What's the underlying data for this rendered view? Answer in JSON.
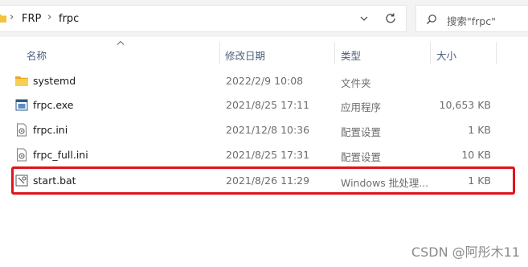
{
  "address_bar": {
    "breadcrumbs": [
      "FRP",
      "frpc"
    ],
    "search_placeholder": "搜索\"frpc\""
  },
  "columns": {
    "name": "名称",
    "date": "修改日期",
    "type": "类型",
    "size": "大小"
  },
  "files": [
    {
      "name": "systemd",
      "date": "2022/2/9 10:08",
      "type": "文件夹",
      "size": "",
      "icon": "folder-icon"
    },
    {
      "name": "frpc.exe",
      "date": "2021/8/25 17:11",
      "type": "应用程序",
      "size": "10,653 KB",
      "icon": "exe-icon"
    },
    {
      "name": "frpc.ini",
      "date": "2021/12/8 10:36",
      "type": "配置设置",
      "size": "1 KB",
      "icon": "ini-icon"
    },
    {
      "name": "frpc_full.ini",
      "date": "2021/8/25 17:31",
      "type": "配置设置",
      "size": "10 KB",
      "icon": "ini-icon"
    },
    {
      "name": "start.bat",
      "date": "2021/8/26 11:29",
      "type": "Windows 批处理...",
      "size": "1 KB",
      "icon": "bat-icon"
    }
  ],
  "highlight_color": "#e0141e",
  "watermark": "CSDN @阿彤木11"
}
